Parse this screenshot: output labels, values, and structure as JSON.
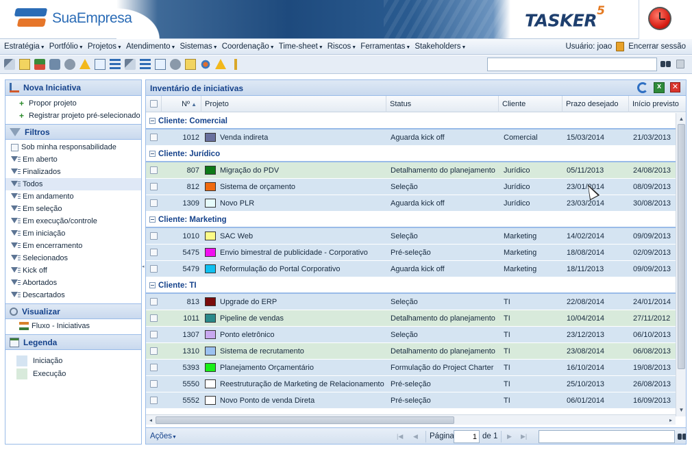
{
  "header": {
    "company_logo_text": "SuaEmpresa",
    "product_name": "TASKER",
    "product_version": "5"
  },
  "menu": {
    "items": [
      "Estratégia",
      "Portfólio",
      "Projetos",
      "Atendimento",
      "Sistemas",
      "Coordenação",
      "Time-sheet",
      "Riscos",
      "Ferramentas",
      "Stakeholders"
    ],
    "user_label": "Usuário: joao",
    "logout_label": "Encerrar sessão"
  },
  "toolbar": {
    "search_value": ""
  },
  "sidebar": {
    "nova_iniciativa": {
      "title": "Nova Iniciativa",
      "items": [
        "Propor projeto",
        "Registrar projeto pré-selecionado"
      ]
    },
    "filtros": {
      "title": "Filtros",
      "checkbox_label": "Sob minha responsabilidade",
      "items": [
        "Em aberto",
        "Finalizados",
        "Todos",
        "Em andamento",
        "Em seleção",
        "Em execução/controle",
        "Em iniciação",
        "Em encerramento",
        "Selecionados",
        "Kick off",
        "Abortados",
        "Descartados"
      ],
      "selected": "Todos"
    },
    "visualizar": {
      "title": "Visualizar",
      "items": [
        "Fluxo - Iniciativas"
      ]
    },
    "legenda": {
      "title": "Legenda",
      "items": [
        {
          "label": "Iniciação",
          "color": "#d5e4f2"
        },
        {
          "label": "Execução",
          "color": "#d8eadb"
        }
      ]
    }
  },
  "grid": {
    "title": "Inventário de iniciativas",
    "columns": {
      "num": "Nº",
      "projeto": "Projeto",
      "status": "Status",
      "cliente": "Cliente",
      "prazo": "Prazo desejado",
      "inicio": "Início previsto"
    },
    "groups": [
      {
        "label": "Cliente: Comercial",
        "rows": [
          {
            "num": "1012",
            "projeto": "Venda indireta",
            "color": "#69709e",
            "status": "Aguarda kick off",
            "cliente": "Comercial",
            "prazo": "15/03/2014",
            "inicio": "21/03/2013",
            "phase": "ini"
          }
        ]
      },
      {
        "label": "Cliente: Jurídico",
        "rows": [
          {
            "num": "807",
            "projeto": "Migração do PDV",
            "color": "#0e7a18",
            "status": "Detalhamento do planejamento",
            "cliente": "Jurídico",
            "prazo": "05/11/2013",
            "inicio": "24/08/2013",
            "phase": "exe"
          },
          {
            "num": "812",
            "projeto": "Sistema de orçamento",
            "color": "#f06a10",
            "status": "Seleção",
            "cliente": "Jurídico",
            "prazo": "23/01/2014",
            "inicio": "08/09/2013",
            "phase": "ini"
          },
          {
            "num": "1309",
            "projeto": "Novo PLR",
            "color": "#e6fbfb",
            "status": "Aguarda kick off",
            "cliente": "Jurídico",
            "prazo": "23/03/2014",
            "inicio": "30/08/2013",
            "phase": "ini"
          }
        ]
      },
      {
        "label": "Cliente: Marketing",
        "rows": [
          {
            "num": "1010",
            "projeto": "SAC Web",
            "color": "#fbfb88",
            "status": "Seleção",
            "cliente": "Marketing",
            "prazo": "14/02/2014",
            "inicio": "09/09/2013",
            "phase": "ini"
          },
          {
            "num": "5475",
            "projeto": "Envio bimestral de publicidade - Corporativo",
            "color": "#f010f0",
            "status": "Pré-seleção",
            "cliente": "Marketing",
            "prazo": "18/08/2014",
            "inicio": "02/09/2013",
            "phase": "ini"
          },
          {
            "num": "5479",
            "projeto": "Reformulação do Portal Corporativo",
            "color": "#10c0f0",
            "status": "Aguarda kick off",
            "cliente": "Marketing",
            "prazo": "18/11/2013",
            "inicio": "09/09/2013",
            "phase": "ini"
          }
        ]
      },
      {
        "label": "Cliente: TI",
        "rows": [
          {
            "num": "813",
            "projeto": "Upgrade do ERP",
            "color": "#7a0c0c",
            "status": "Seleção",
            "cliente": "TI",
            "prazo": "22/08/2014",
            "inicio": "24/01/2014",
            "phase": "ini"
          },
          {
            "num": "1011",
            "projeto": "Pipeline de vendas",
            "color": "#2a8a8a",
            "status": "Detalhamento do planejamento",
            "cliente": "TI",
            "prazo": "10/04/2014",
            "inicio": "27/11/2012",
            "phase": "exe"
          },
          {
            "num": "1307",
            "projeto": "Ponto eletrônico",
            "color": "#c8a8f0",
            "status": "Seleção",
            "cliente": "TI",
            "prazo": "23/12/2013",
            "inicio": "06/10/2013",
            "phase": "ini"
          },
          {
            "num": "1310",
            "projeto": "Sistema de recrutamento",
            "color": "#9cc2f0",
            "status": "Detalhamento do planejamento",
            "cliente": "TI",
            "prazo": "23/08/2014",
            "inicio": "06/08/2013",
            "phase": "exe"
          },
          {
            "num": "5393",
            "projeto": "Planejamento Orçamentário",
            "color": "#18f018",
            "status": "Formulação do Project Charter",
            "cliente": "TI",
            "prazo": "16/10/2014",
            "inicio": "19/08/2013",
            "phase": "ini"
          },
          {
            "num": "5550",
            "projeto": "Reestruturação de Marketing de Relacionamento",
            "color": "#ffffff",
            "status": "Pré-seleção",
            "cliente": "TI",
            "prazo": "25/10/2013",
            "inicio": "26/08/2013",
            "phase": "ini"
          },
          {
            "num": "5552",
            "projeto": "Novo Ponto de venda Direta",
            "color": "#ffffff",
            "status": "Pré-seleção",
            "cliente": "TI",
            "prazo": "06/01/2014",
            "inicio": "16/09/2013",
            "phase": "ini"
          }
        ]
      }
    ]
  },
  "pager": {
    "actions_label": "Ações",
    "page_label": "Página",
    "page_value": "1",
    "of_label": "de 1",
    "search_value": ""
  }
}
